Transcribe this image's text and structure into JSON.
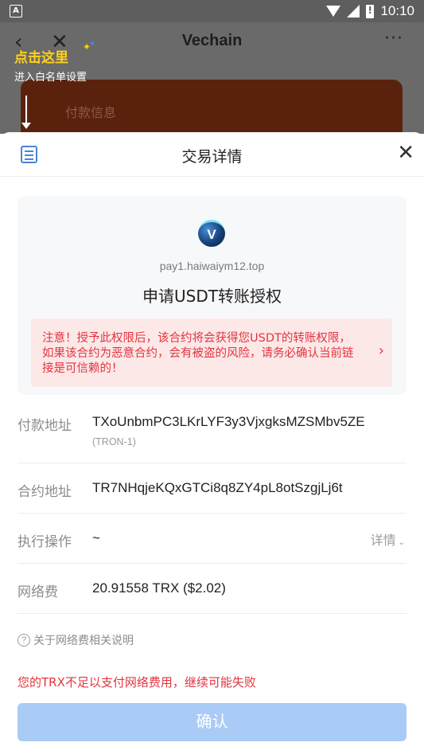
{
  "status_bar": {
    "app_icon_letter": "A",
    "time": "10:10"
  },
  "background_page": {
    "title": "Vechain",
    "tip_title": "点击这里",
    "tip_subtitle": "进入白名单设置",
    "card_text": "付款信息"
  },
  "sheet": {
    "title": "交易详情",
    "dapp": {
      "url": "pay1.haiwaiym12.top",
      "request_title": "申请USDT转账授权"
    },
    "warning": "注意！授予此权限后，该合约将会获得您USDT的转账权限，如果该合约为恶意合约，会有被盗的风险，请务必确认当前链接是可信赖的！",
    "rows": {
      "payment_address": {
        "label": "付款地址",
        "value": "TXoUnbmPC3LKrLYF3y3VjxgksMZSMbv5ZE",
        "network": "(TRON-1)"
      },
      "contract_address": {
        "label": "合约地址",
        "value": "TR7NHqjeKQxGTCi8q8ZY4pL8otSzgjLj6t"
      },
      "operation": {
        "label": "执行操作",
        "value": "~",
        "detail": "详情"
      },
      "network_fee": {
        "label": "网络费",
        "value": "20.91558 TRX ($2.02)"
      }
    },
    "fee_note": "关于网络费相关说明",
    "insufficient_warning": "您的TRX不足以支付网络费用，继续可能失败",
    "confirm_label": "确认"
  },
  "colors": {
    "accent_blue": "#4a84d6",
    "button_disabled": "#a9cbf6",
    "warning_red": "#e2343f",
    "warning_bg": "#fde8e8",
    "tip_yellow": "#ffd21a"
  }
}
